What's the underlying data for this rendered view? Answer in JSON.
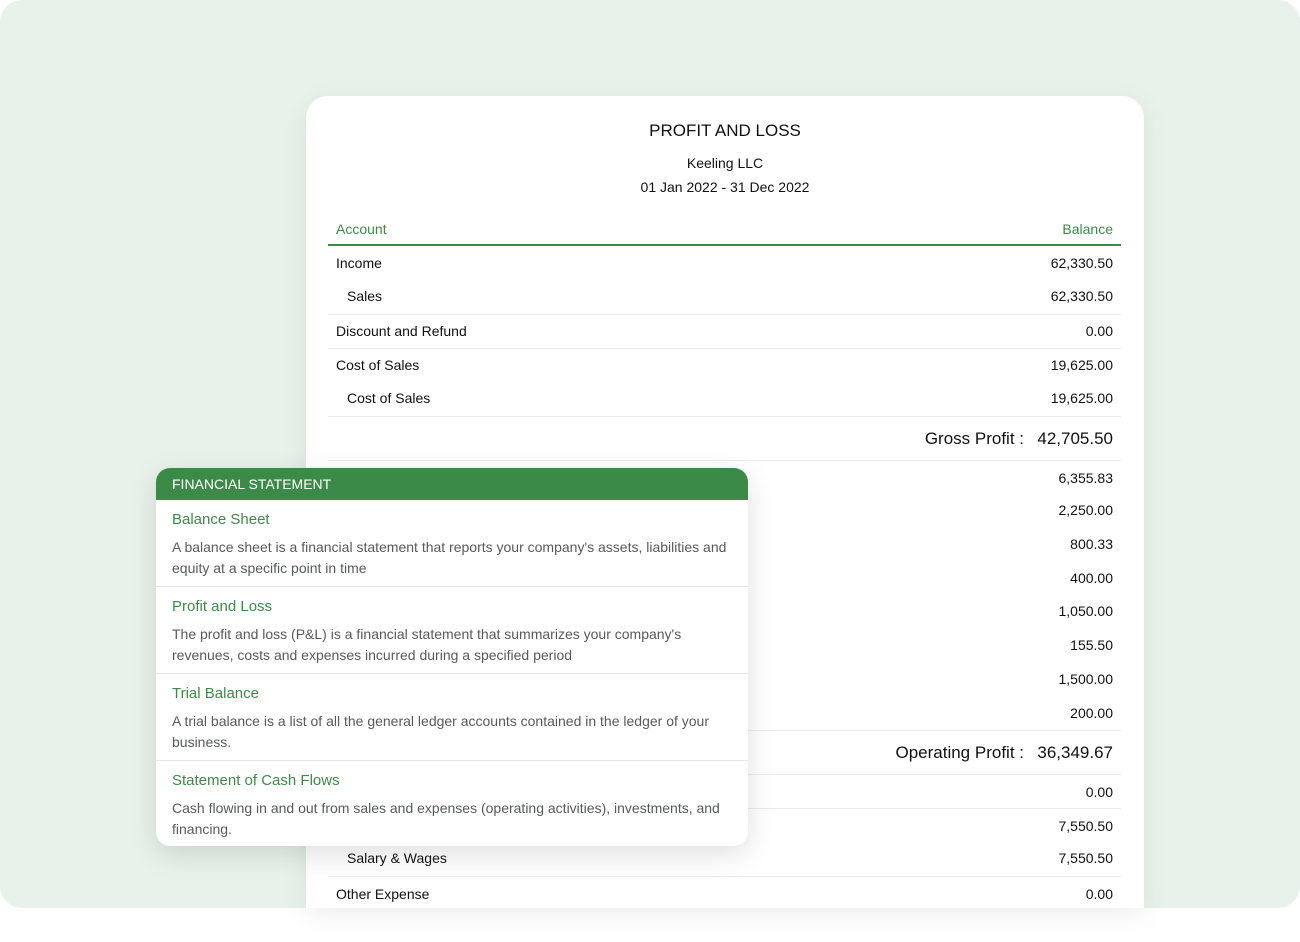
{
  "report": {
    "title": "PROFIT AND LOSS",
    "company": "Keeling LLC",
    "period": "01 Jan 2022 - 31 Dec 2022",
    "columns": {
      "account": "Account",
      "balance": "Balance"
    },
    "rows": [
      {
        "label": "Income",
        "value": "62,330.50"
      },
      {
        "label": "Sales",
        "value": "62,330.50"
      },
      {
        "label": "Discount and Refund",
        "value": "0.00"
      },
      {
        "label": "Cost of Sales",
        "value": "19,625.00"
      },
      {
        "label": "Cost of Sales",
        "value": "19,625.00"
      },
      {
        "label": "",
        "value": "6,355.83"
      },
      {
        "label": "",
        "value": "2,250.00"
      },
      {
        "label": "",
        "value": "800.33"
      },
      {
        "label": "",
        "value": "400.00"
      },
      {
        "label": "",
        "value": "1,050.00"
      },
      {
        "label": "",
        "value": "155.50"
      },
      {
        "label": "",
        "value": "1,500.00"
      },
      {
        "label": "",
        "value": "200.00"
      },
      {
        "label": "",
        "value": "0.00"
      },
      {
        "label": "",
        "value": "7,550.50"
      },
      {
        "label": "Salary & Wages",
        "value": "7,550.50"
      },
      {
        "label": "Other Expense",
        "value": "0.00"
      }
    ],
    "totals": {
      "gross_profit": {
        "label": "Gross Profit :",
        "value": "42,705.50"
      },
      "operating_profit": {
        "label": "Operating Profit :",
        "value": "36,349.67"
      }
    }
  },
  "financial_statement": {
    "header": "FINANCIAL STATEMENT",
    "items": [
      {
        "title": "Balance Sheet",
        "description": "A balance sheet is a financial statement that reports your company's assets, liabilities and equity at a specific point in time"
      },
      {
        "title": "Profit and Loss",
        "description": "The profit and loss (P&L) is a financial statement that summarizes your company's revenues, costs and expenses incurred during a specified period"
      },
      {
        "title": "Trial Balance",
        "description": "A trial balance is a list of all the general ledger accounts contained in the ledger of your business."
      },
      {
        "title": "Statement of Cash Flows",
        "description": "Cash flowing in and out from sales and expenses (operating activities), investments, and financing."
      }
    ]
  },
  "colors": {
    "accent": "#3c8a47",
    "background": "#e8f2ea"
  }
}
